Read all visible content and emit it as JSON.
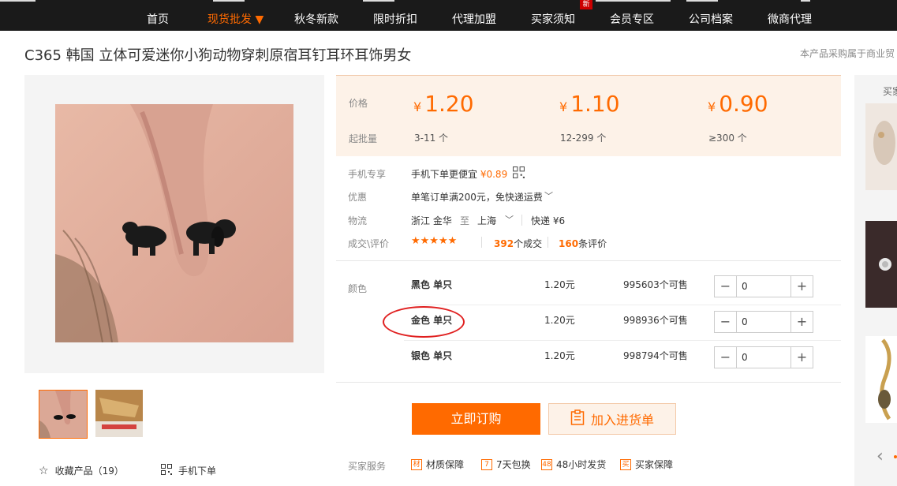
{
  "nav": {
    "items": [
      "首页",
      "现货批发",
      "秋冬新款",
      "限时折扣",
      "代理加盟",
      "买家须知",
      "会员专区",
      "公司档案",
      "微商代理"
    ],
    "active_arrow": "▼",
    "new_badge": "新"
  },
  "product": {
    "title": "C365 韩国 立体可爱迷你小狗动物穿刺原宿耳钉耳环耳饰男女",
    "notice": "本产品采购属于商业贸"
  },
  "pricing": {
    "price_label": "价格",
    "min_label": "起批量",
    "currency": "¥",
    "tiers": [
      {
        "price": "1.20",
        "range": "3-11 个"
      },
      {
        "price": "1.10",
        "range": "12-299 个"
      },
      {
        "price": "0.90",
        "range": "≥300 个"
      }
    ]
  },
  "info": {
    "mobile_label": "手机专享",
    "mobile_text": "手机下单更便宜",
    "mobile_price": "¥0.89",
    "discount_label": "优惠",
    "discount_text": "单笔订单满200元，免快递运费",
    "logistics_label": "物流",
    "logistics_from": "浙江 金华",
    "logistics_to_word": "至",
    "logistics_to": "上海",
    "logistics_fee": "快递 ¥6",
    "deal_label": "成交\\评价",
    "stars": "★★★★★",
    "deals_count": "392",
    "deals_suffix": "个成交",
    "reviews_count": "160",
    "reviews_suffix": "条评价"
  },
  "variants": {
    "label": "颜色",
    "rows": [
      {
        "name": "黑色 单只",
        "price": "1.20元",
        "stock": "995603个可售",
        "qty": "0"
      },
      {
        "name": "金色 单只",
        "price": "1.20元",
        "stock": "998936个可售",
        "qty": "0"
      },
      {
        "name": "银色 单只",
        "price": "1.20元",
        "stock": "998794个可售",
        "qty": "0"
      }
    ],
    "minus": "−",
    "plus": "+"
  },
  "actions": {
    "buy_label": "立即订购",
    "cart_label": "加入进货单"
  },
  "services": {
    "label": "买家服务",
    "items": [
      {
        "icon": "材",
        "text": "材质保障"
      },
      {
        "icon": "7",
        "text": "7天包换"
      },
      {
        "icon": "48",
        "text": "48小时发货"
      },
      {
        "icon": "买",
        "text": "买家保障"
      }
    ]
  },
  "left_links": {
    "favorite": "收藏产品（19）",
    "mobile_order": "手机下单"
  },
  "sidebar": {
    "title": "买家",
    "prev_arrow": "‹"
  },
  "colors": {
    "accent": "#ff6a00",
    "price_panel_bg": "#fdf2e8",
    "nav_bg": "#1a1a1a",
    "annotation": "#e02020"
  }
}
